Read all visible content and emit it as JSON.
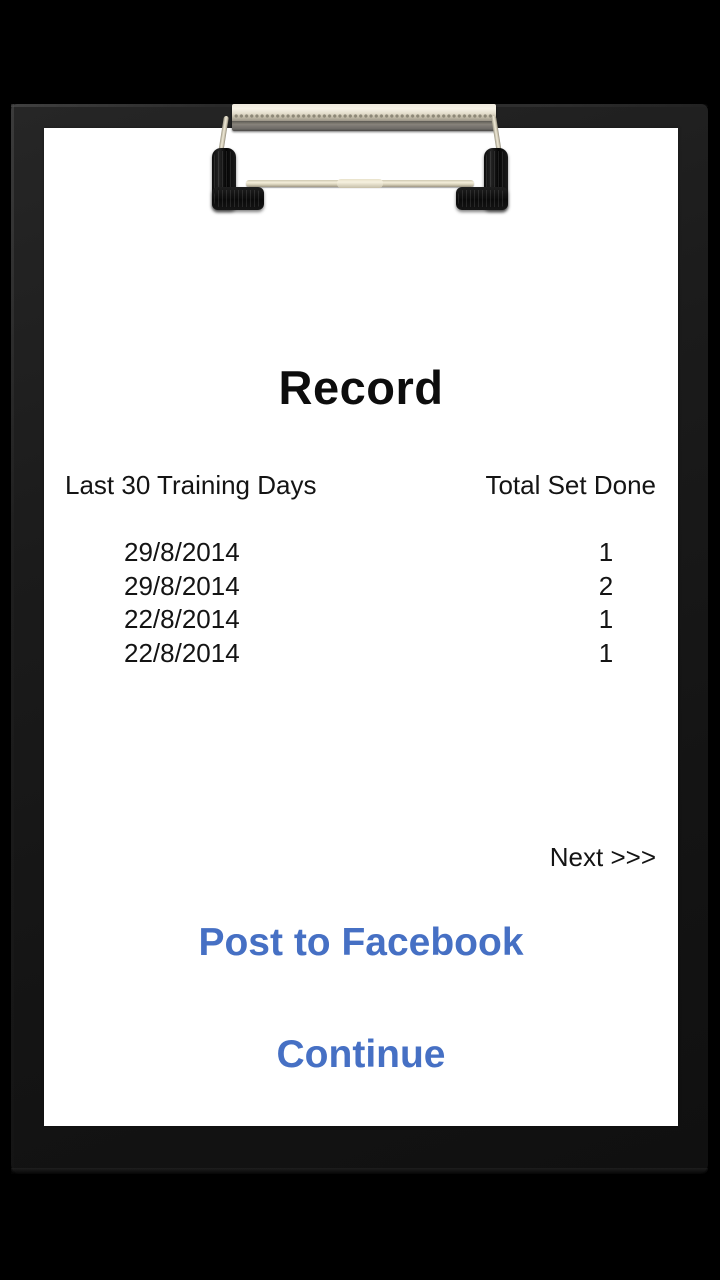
{
  "app": {
    "background_color": "#000000",
    "board_color": "#1b1b1b",
    "paper_color": "#ffffff",
    "accent_color": "#4670c4",
    "text_color": "#141414"
  },
  "clipboard": {
    "clip_icon": "clipboard-clip-icon",
    "grip_left_icon": "clip-grip-left-icon",
    "grip_right_icon": "clip-grip-right-icon"
  },
  "page": {
    "title": "Record"
  },
  "table": {
    "headers": {
      "left": "Last 30 Training Days",
      "right": "Total Set Done"
    },
    "rows": [
      {
        "date": "29/8/2014",
        "sets": "1"
      },
      {
        "date": "29/8/2014",
        "sets": "2"
      },
      {
        "date": "22/8/2014",
        "sets": "1"
      },
      {
        "date": "22/8/2014",
        "sets": "1"
      }
    ]
  },
  "actions": {
    "next": "Next >>>",
    "post_to_facebook": "Post to Facebook",
    "continue": "Continue"
  }
}
